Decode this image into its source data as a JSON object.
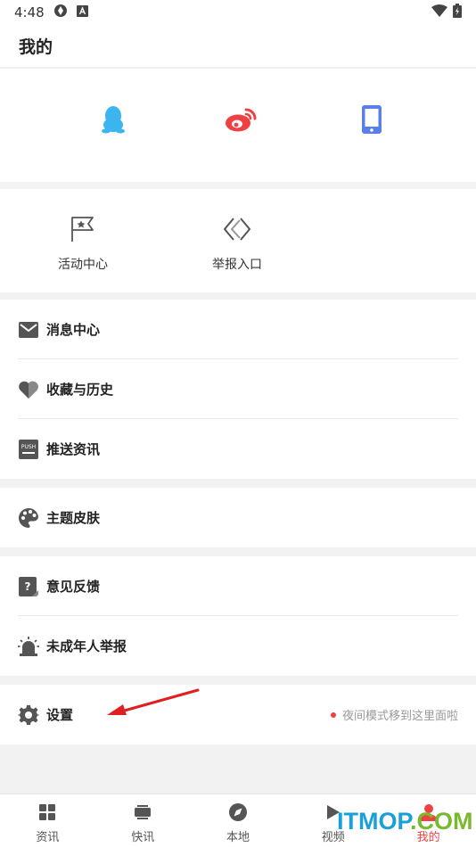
{
  "status_bar": {
    "time": "4:48"
  },
  "header": {
    "title": "我的"
  },
  "login": {
    "icons": [
      "qq-icon",
      "weibo-icon",
      "phone-icon"
    ],
    "colors": {
      "qq": "#3cb4f0",
      "weibo": "#f04142",
      "phone": "#5b7fe8"
    }
  },
  "quick": [
    {
      "label": "活动中心",
      "icon": "flag-star-icon"
    },
    {
      "label": "举报入口",
      "icon": "report-arrows-icon"
    }
  ],
  "menu": {
    "messages": "消息中心",
    "favorites": "收藏与历史",
    "push": "推送资讯",
    "theme": "主题皮肤",
    "feedback": "意见反馈",
    "minor_report": "未成年人举报",
    "settings": "设置",
    "settings_hint": "夜间模式移到这里面啦"
  },
  "bottom_nav": [
    {
      "label": "资讯",
      "icon": "grid-icon"
    },
    {
      "label": "快讯",
      "icon": "tv-icon"
    },
    {
      "label": "本地",
      "icon": "compass-icon"
    },
    {
      "label": "视频",
      "icon": "play-icon"
    },
    {
      "label": "我的",
      "icon": "user-icon",
      "active": true
    }
  ],
  "watermark": {
    "part1": "ITMOP",
    "part2": ".COM"
  },
  "accent_color": "#f04142"
}
